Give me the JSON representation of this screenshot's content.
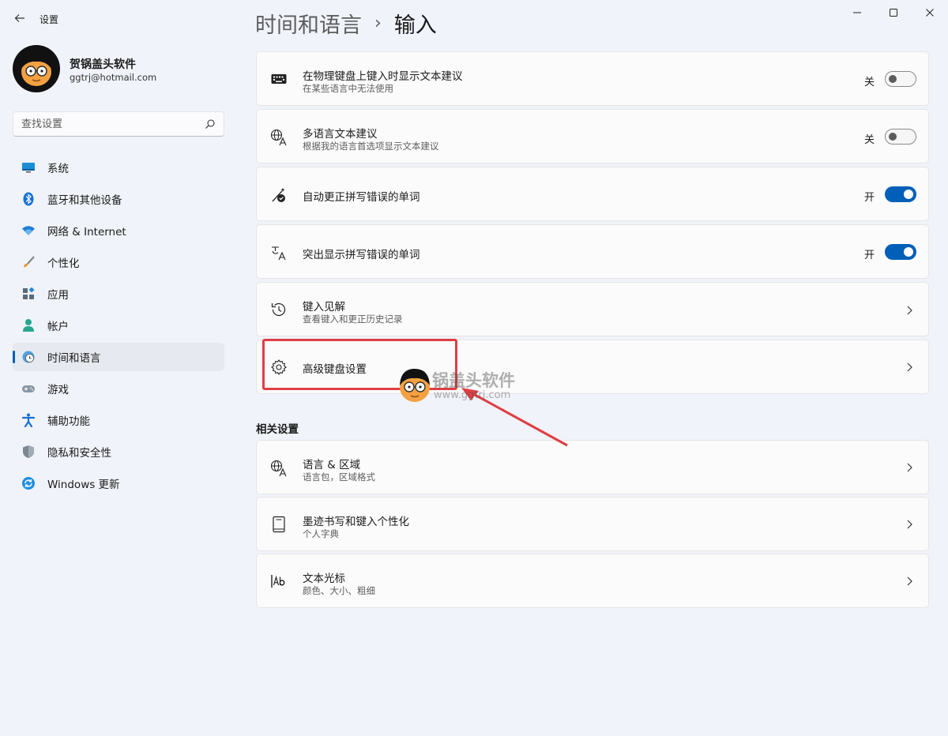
{
  "window": {
    "title": "设置"
  },
  "user": {
    "name": "贺锅盖头软件",
    "email": "ggtrj@hotmail.com"
  },
  "search": {
    "placeholder": "查找设置"
  },
  "sidebar": {
    "items": [
      {
        "label": "系统",
        "icon": "system-icon"
      },
      {
        "label": "蓝牙和其他设备",
        "icon": "bluetooth-icon"
      },
      {
        "label": "网络 & Internet",
        "icon": "wifi-icon"
      },
      {
        "label": "个性化",
        "icon": "brush-icon"
      },
      {
        "label": "应用",
        "icon": "apps-icon"
      },
      {
        "label": "帐户",
        "icon": "account-icon"
      },
      {
        "label": "时间和语言",
        "icon": "time-language-icon",
        "active": true
      },
      {
        "label": "游戏",
        "icon": "gamepad-icon"
      },
      {
        "label": "辅助功能",
        "icon": "accessibility-icon"
      },
      {
        "label": "隐私和安全性",
        "icon": "shield-icon"
      },
      {
        "label": "Windows 更新",
        "icon": "update-icon"
      }
    ]
  },
  "breadcrumb": {
    "parent": "时间和语言",
    "separator": "›",
    "current": "输入"
  },
  "settings": [
    {
      "title": "在物理键盘上键入时显示文本建议",
      "desc": "在某些语言中无法使用",
      "state": "关",
      "on": false,
      "icon": "keyboard-icon"
    },
    {
      "title": "多语言文本建议",
      "desc": "根据我的语言首选项显示文本建议",
      "state": "关",
      "on": false,
      "icon": "language-icon"
    },
    {
      "title": "自动更正拼写错误的单词",
      "state": "开",
      "on": true,
      "icon": "autocorrect-icon"
    },
    {
      "title": "突出显示拼写错误的单词",
      "state": "开",
      "on": true,
      "icon": "spellcheck-icon"
    },
    {
      "title": "键入见解",
      "desc": "查看键入和更正历史记录",
      "icon": "history-icon"
    },
    {
      "title": "高级键盘设置",
      "icon": "gear-icon"
    }
  ],
  "related": {
    "heading": "相关设置",
    "items": [
      {
        "title": "语言 & 区域",
        "desc": "语言包，区域格式",
        "icon": "language-icon"
      },
      {
        "title": "墨迹书写和键入个性化",
        "desc": "个人字典",
        "icon": "dictionary-icon"
      },
      {
        "title": "文本光标",
        "desc": "颜色、大小、粗细",
        "icon": "text-cursor-icon"
      }
    ]
  },
  "watermark": {
    "text": "锅盖头软件",
    "url": "www.ggtrj.com"
  },
  "colors": {
    "accent": "#005fb8",
    "annotation": "#e03e43",
    "background": "#f0f3f9",
    "card": "#fbfbfc"
  }
}
